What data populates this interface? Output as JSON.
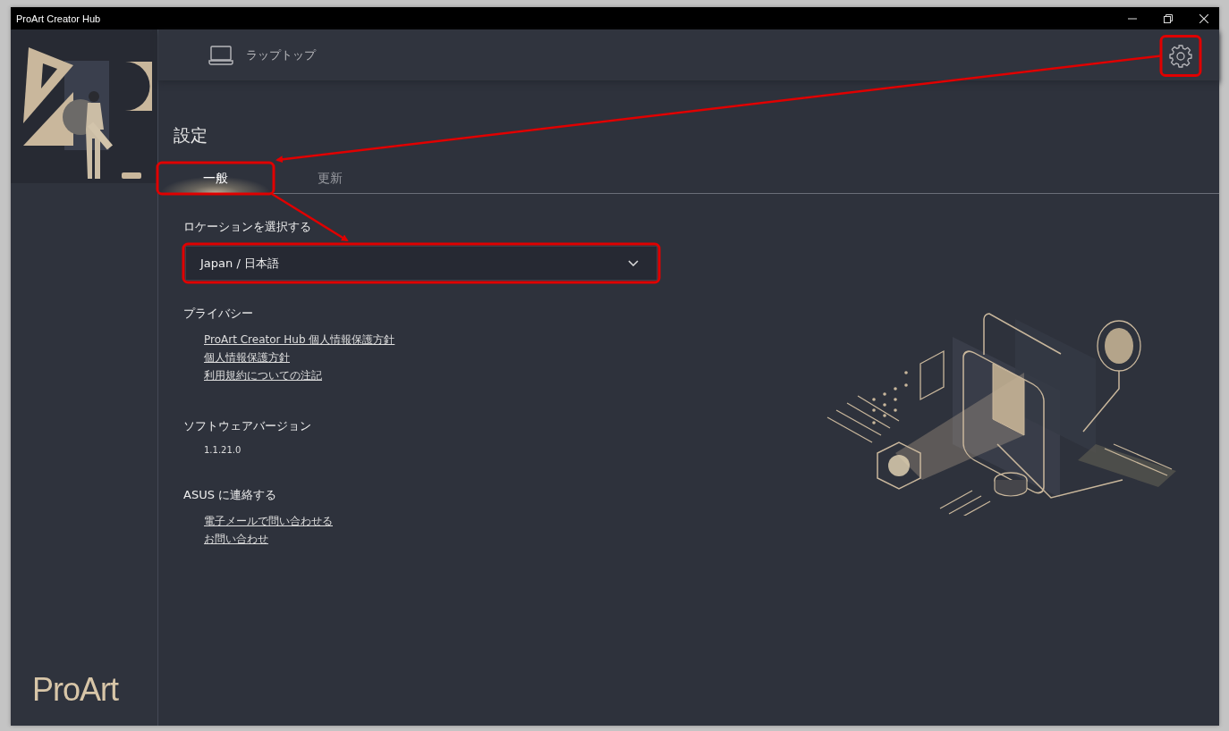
{
  "window": {
    "title": "ProArt Creator Hub"
  },
  "sidebar": {
    "logo": "ProArt"
  },
  "top_bar": {
    "device": "ラップトップ"
  },
  "page_title": "設定",
  "tabs": [
    {
      "label": "一般",
      "selected": true
    },
    {
      "label": "更新",
      "selected": false
    }
  ],
  "location": {
    "label": "ロケーションを選択する",
    "value": "Japan / 日本語"
  },
  "sections": [
    {
      "heading": "プライバシー",
      "kind": "links",
      "items": [
        "ProArt Creator Hub 個人情報保護方針",
        "個人情報保護方針",
        "利用規約についての注記"
      ]
    },
    {
      "heading": "ソフトウェアバージョン",
      "kind": "text",
      "items": [
        "1.1.21.0"
      ]
    },
    {
      "heading": "ASUS に連絡する",
      "kind": "links",
      "items": [
        "電子メールで問い合わせる",
        "お問い合わせ"
      ]
    }
  ]
}
